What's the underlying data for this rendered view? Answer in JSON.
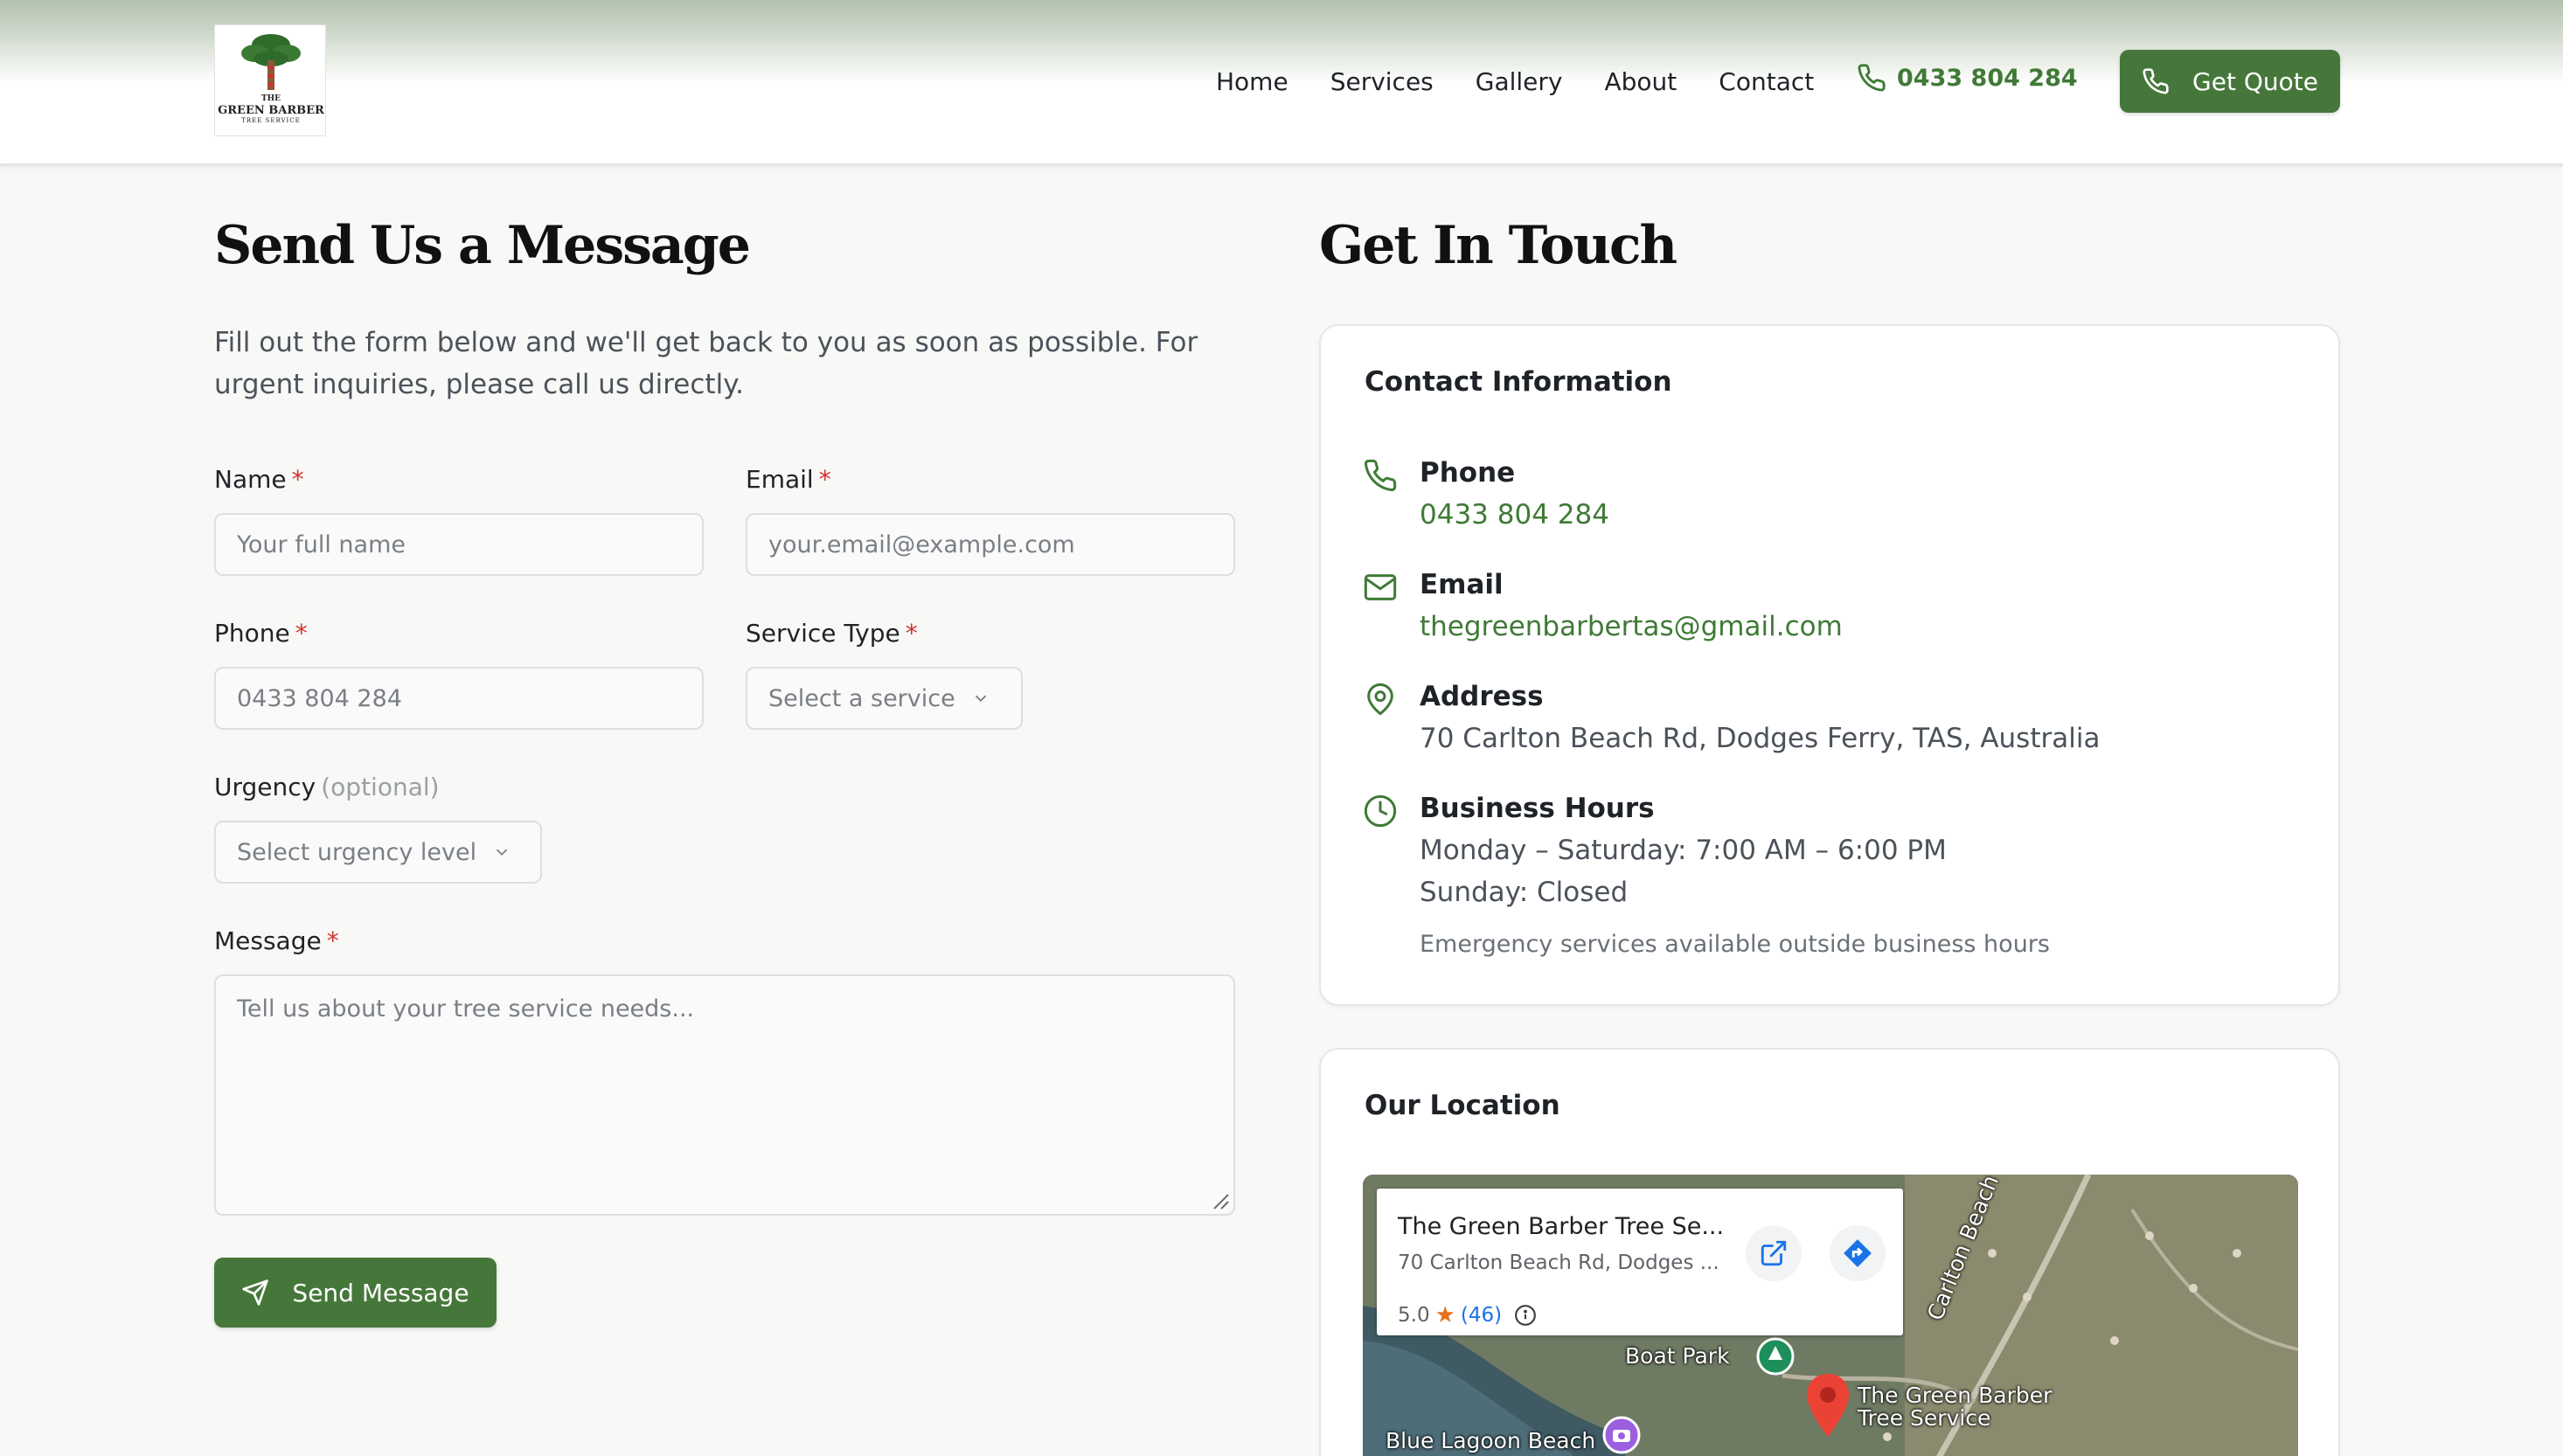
{
  "header": {
    "logo": {
      "line1": "THE",
      "line2": "GREEN BARBER",
      "line3": "TREE SERVICE"
    },
    "nav": [
      "Home",
      "Services",
      "Gallery",
      "About",
      "Contact"
    ],
    "phone": "0433 804 284",
    "quote_button": "Get Quote"
  },
  "form": {
    "title": "Send Us a Message",
    "intro": "Fill out the form below and we'll get back to you as soon as possible. For urgent inquiries, please call us directly.",
    "required_mark": "*",
    "name": {
      "label": "Name",
      "placeholder": "Your full name"
    },
    "email": {
      "label": "Email",
      "placeholder": "your.email@example.com"
    },
    "phone": {
      "label": "Phone",
      "placeholder": "0433 804 284"
    },
    "service": {
      "label": "Service Type",
      "placeholder": "Select a service"
    },
    "urgency": {
      "label": "Urgency",
      "optional": "(optional)",
      "placeholder": "Select urgency level"
    },
    "message": {
      "label": "Message",
      "placeholder": "Tell us about your tree service needs..."
    },
    "submit": "Send Message"
  },
  "contact": {
    "title": "Get In Touch",
    "card_title": "Contact Information",
    "phone": {
      "label": "Phone",
      "value": "0433 804 284"
    },
    "email": {
      "label": "Email",
      "value": "thegreenbarbertas@gmail.com"
    },
    "address": {
      "label": "Address",
      "value": "70 Carlton Beach Rd, Dodges Ferry, TAS, Australia"
    },
    "hours": {
      "label": "Business Hours",
      "weekdays": "Monday – Saturday: 7:00 AM – 6:00 PM",
      "sunday": "Sunday: Closed",
      "note": "Emergency services available outside business hours"
    }
  },
  "location": {
    "title": "Our Location",
    "map": {
      "place_name": "The Green Barber Tree Se...",
      "place_address": "70 Carlton Beach Rd, Dodges ...",
      "rating": "5.0",
      "review_count": "(46)",
      "labels": {
        "boat_park": "Boat Park",
        "road": "Carlton Beach Rd",
        "pin_line1": "The Green Barber",
        "pin_line2": "Tree Service",
        "beach": "Blue Lagoon Beach"
      }
    }
  },
  "colors": {
    "brand_green": "#46773a",
    "link_green": "#3f7a36",
    "required_red": "#d0342c"
  }
}
